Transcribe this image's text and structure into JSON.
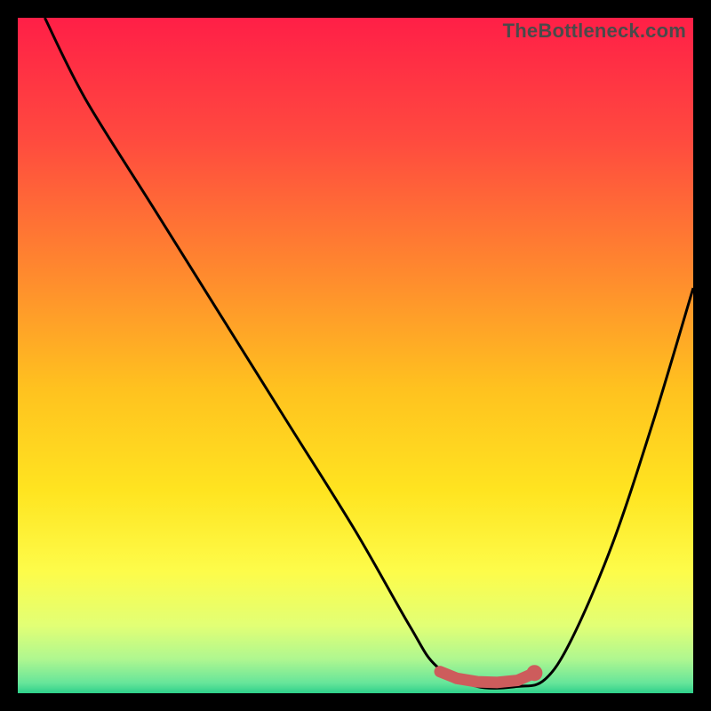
{
  "watermark": "TheBottleneck.com",
  "colors": {
    "frame": "#000000",
    "curve": "#000000",
    "marker": "#cd5c5c",
    "gradient_stops": [
      {
        "offset": 0.0,
        "color": "#ff1f47"
      },
      {
        "offset": 0.18,
        "color": "#ff4a3f"
      },
      {
        "offset": 0.38,
        "color": "#ff8a2e"
      },
      {
        "offset": 0.55,
        "color": "#ffc21f"
      },
      {
        "offset": 0.7,
        "color": "#ffe420"
      },
      {
        "offset": 0.82,
        "color": "#fdfc4a"
      },
      {
        "offset": 0.9,
        "color": "#e2ff75"
      },
      {
        "offset": 0.95,
        "color": "#aef790"
      },
      {
        "offset": 0.985,
        "color": "#66e59a"
      },
      {
        "offset": 1.0,
        "color": "#2ecf8a"
      }
    ]
  },
  "chart_data": {
    "type": "line",
    "title": "",
    "xlabel": "",
    "ylabel": "",
    "xlim": [
      0,
      100
    ],
    "ylim": [
      0,
      100
    ],
    "grid": false,
    "legend": null,
    "series": [
      {
        "name": "bottleneck-curve",
        "x": [
          4,
          10,
          20,
          30,
          40,
          50,
          58,
          62,
          68,
          74,
          78,
          82,
          88,
          94,
          100
        ],
        "y": [
          100,
          88,
          72,
          56,
          40,
          24,
          10,
          4,
          1,
          1,
          2,
          8,
          22,
          40,
          60
        ]
      }
    ],
    "markers": {
      "name": "optimal-range",
      "x": [
        62.5,
        65,
        68,
        71,
        74,
        76.5
      ],
      "y": [
        3.2,
        2.2,
        1.7,
        1.6,
        1.9,
        3.0
      ]
    }
  }
}
